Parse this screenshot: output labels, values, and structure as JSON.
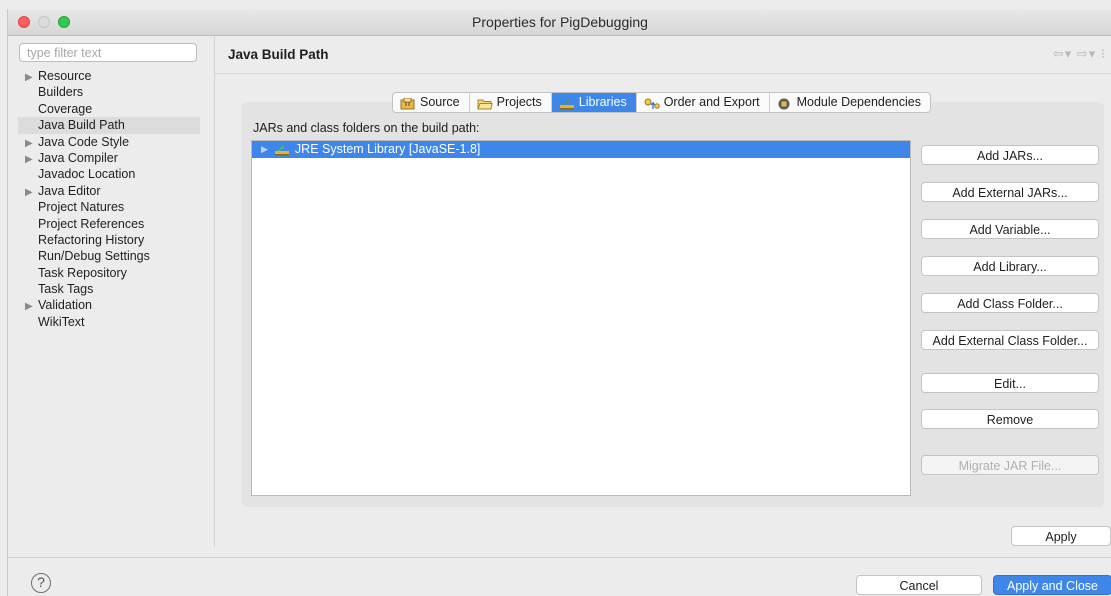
{
  "window": {
    "title": "Properties for PigDebugging"
  },
  "sidebar": {
    "filter_placeholder": "type filter text",
    "items": [
      {
        "label": "Resource",
        "expandable": true
      },
      {
        "label": "Builders",
        "expandable": false
      },
      {
        "label": "Coverage",
        "expandable": false
      },
      {
        "label": "Java Build Path",
        "expandable": false,
        "selected": true
      },
      {
        "label": "Java Code Style",
        "expandable": true
      },
      {
        "label": "Java Compiler",
        "expandable": true
      },
      {
        "label": "Javadoc Location",
        "expandable": false
      },
      {
        "label": "Java Editor",
        "expandable": true
      },
      {
        "label": "Project Natures",
        "expandable": false
      },
      {
        "label": "Project References",
        "expandable": false
      },
      {
        "label": "Refactoring History",
        "expandable": false
      },
      {
        "label": "Run/Debug Settings",
        "expandable": false
      },
      {
        "label": "Task Repository",
        "expandable": false
      },
      {
        "label": "Task Tags",
        "expandable": false
      },
      {
        "label": "Validation",
        "expandable": true
      },
      {
        "label": "WikiText",
        "expandable": false
      }
    ]
  },
  "content": {
    "page_title": "Java Build Path",
    "nav_arrows": "⇦▾ ⇨▾ ⁝",
    "tabs": [
      {
        "label": "Source",
        "icon": "source-icon"
      },
      {
        "label": "Projects",
        "icon": "folder-icon"
      },
      {
        "label": "Libraries",
        "icon": "libraries-icon",
        "active": true
      },
      {
        "label": "Order and Export",
        "icon": "order-export-icon"
      },
      {
        "label": "Module Dependencies",
        "icon": "module-icon"
      }
    ],
    "list_label": "JARs and class folders on the build path:",
    "libraries": [
      {
        "label": "JRE System Library [JavaSE-1.8]",
        "selected": true
      }
    ],
    "buttons": [
      {
        "label": "Add JARs...",
        "enabled": true
      },
      {
        "label": "Add External JARs...",
        "enabled": true
      },
      {
        "label": "Add Variable...",
        "enabled": true
      },
      {
        "label": "Add Library...",
        "enabled": true
      },
      {
        "label": "Add Class Folder...",
        "enabled": true
      },
      {
        "label": "Add External Class Folder...",
        "enabled": true
      },
      {
        "label": "Edit...",
        "enabled": true
      },
      {
        "label": "Remove",
        "enabled": true
      },
      {
        "label": "Migrate JAR File...",
        "enabled": false
      }
    ],
    "apply_label": "Apply"
  },
  "footer": {
    "help_glyph": "?",
    "cancel_label": "Cancel",
    "apply_close_label": "Apply and Close"
  },
  "colors": {
    "accent": "#3e86e8"
  }
}
